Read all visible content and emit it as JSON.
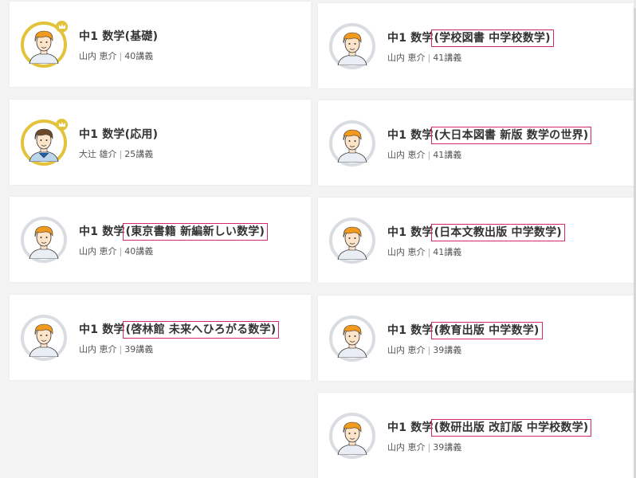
{
  "courses": [
    {
      "title_prefix": "中1 数学",
      "title_sub": "(基礎)",
      "highlight": false,
      "teacher": "山内 恵介",
      "lectures": "40講義",
      "badge": true,
      "face": "orange"
    },
    {
      "title_prefix": "中1 数学",
      "title_sub": "(学校図書 中学校数学)",
      "highlight": true,
      "teacher": "山内 恵介",
      "lectures": "41講義",
      "badge": false,
      "face": "orange"
    },
    {
      "title_prefix": "中1 数学",
      "title_sub": "(応用)",
      "highlight": false,
      "teacher": "大辻 雄介",
      "lectures": "25講義",
      "badge": true,
      "face": "brown"
    },
    {
      "title_prefix": "中1 数学",
      "title_sub": "(大日本図書 新版 数学の世界)",
      "highlight": true,
      "teacher": "山内 恵介",
      "lectures": "41講義",
      "badge": false,
      "face": "orange"
    },
    {
      "title_prefix": "中1 数学",
      "title_sub": "(東京書籍 新編新しい数学)",
      "highlight": true,
      "teacher": "山内 恵介",
      "lectures": "40講義",
      "badge": false,
      "face": "orange"
    },
    {
      "title_prefix": "中1 数学",
      "title_sub": "(日本文教出版 中学数学)",
      "highlight": true,
      "teacher": "山内 恵介",
      "lectures": "41講義",
      "badge": false,
      "face": "orange"
    },
    {
      "title_prefix": "中1 数学",
      "title_sub": "(啓林館 未来へひろがる数学)",
      "highlight": true,
      "teacher": "山内 恵介",
      "lectures": "39講義",
      "badge": false,
      "face": "orange"
    },
    {
      "title_prefix": "中1 数学",
      "title_sub": "(教育出版 中学数学)",
      "highlight": true,
      "teacher": "山内 恵介",
      "lectures": "39講義",
      "badge": false,
      "face": "orange"
    },
    {
      "title_prefix": "中1 数学",
      "title_sub": "(数研出版 改訂版 中学校数学)",
      "highlight": true,
      "teacher": "山内 恵介",
      "lectures": "39講義",
      "badge": false,
      "face": "orange"
    }
  ],
  "meta_separator": "|",
  "colors": {
    "badge_gold": "#e3c23c",
    "highlight_border": "#d4286e",
    "ring_gray": "#d9dde2"
  }
}
